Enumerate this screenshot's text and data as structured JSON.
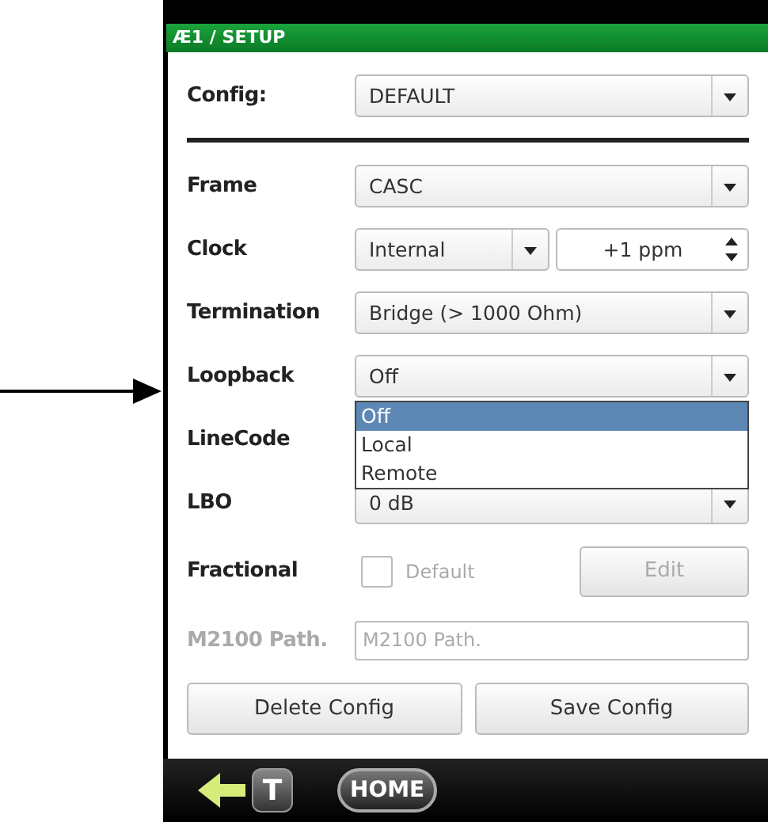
{
  "window": {
    "title": "Æ1 / SETUP"
  },
  "config": {
    "label": "Config:",
    "value": "DEFAULT"
  },
  "rows": [
    {
      "kind": "select",
      "label": "Frame",
      "value": "CASC"
    },
    {
      "kind": "clock",
      "label": "Clock",
      "value": "Internal",
      "offset": "+1 ppm"
    },
    {
      "kind": "select",
      "label": "Termination",
      "value": "Bridge (> 1000 Ohm)"
    },
    {
      "kind": "select",
      "label": "Loopback",
      "value": "Off",
      "expanded": true,
      "options": [
        {
          "label": "Off",
          "selected": true
        },
        {
          "label": "Local",
          "selected": false
        },
        {
          "label": "Remote",
          "selected": false
        }
      ]
    },
    {
      "kind": "label",
      "label": "LineCode"
    },
    {
      "kind": "select",
      "label": "LBO",
      "value": "0 dB"
    },
    {
      "kind": "check",
      "label": "Fractional",
      "checked": false,
      "check_label": "Default",
      "button": "Edit",
      "disabled": true
    },
    {
      "kind": "text",
      "label": "M2100 Path.",
      "placeholder": "M2100 Path.",
      "disabled": true
    }
  ],
  "buttons": [
    "Delete Config",
    "Save Config"
  ],
  "nav": {
    "t_label": "T",
    "home_label": "HOME"
  }
}
